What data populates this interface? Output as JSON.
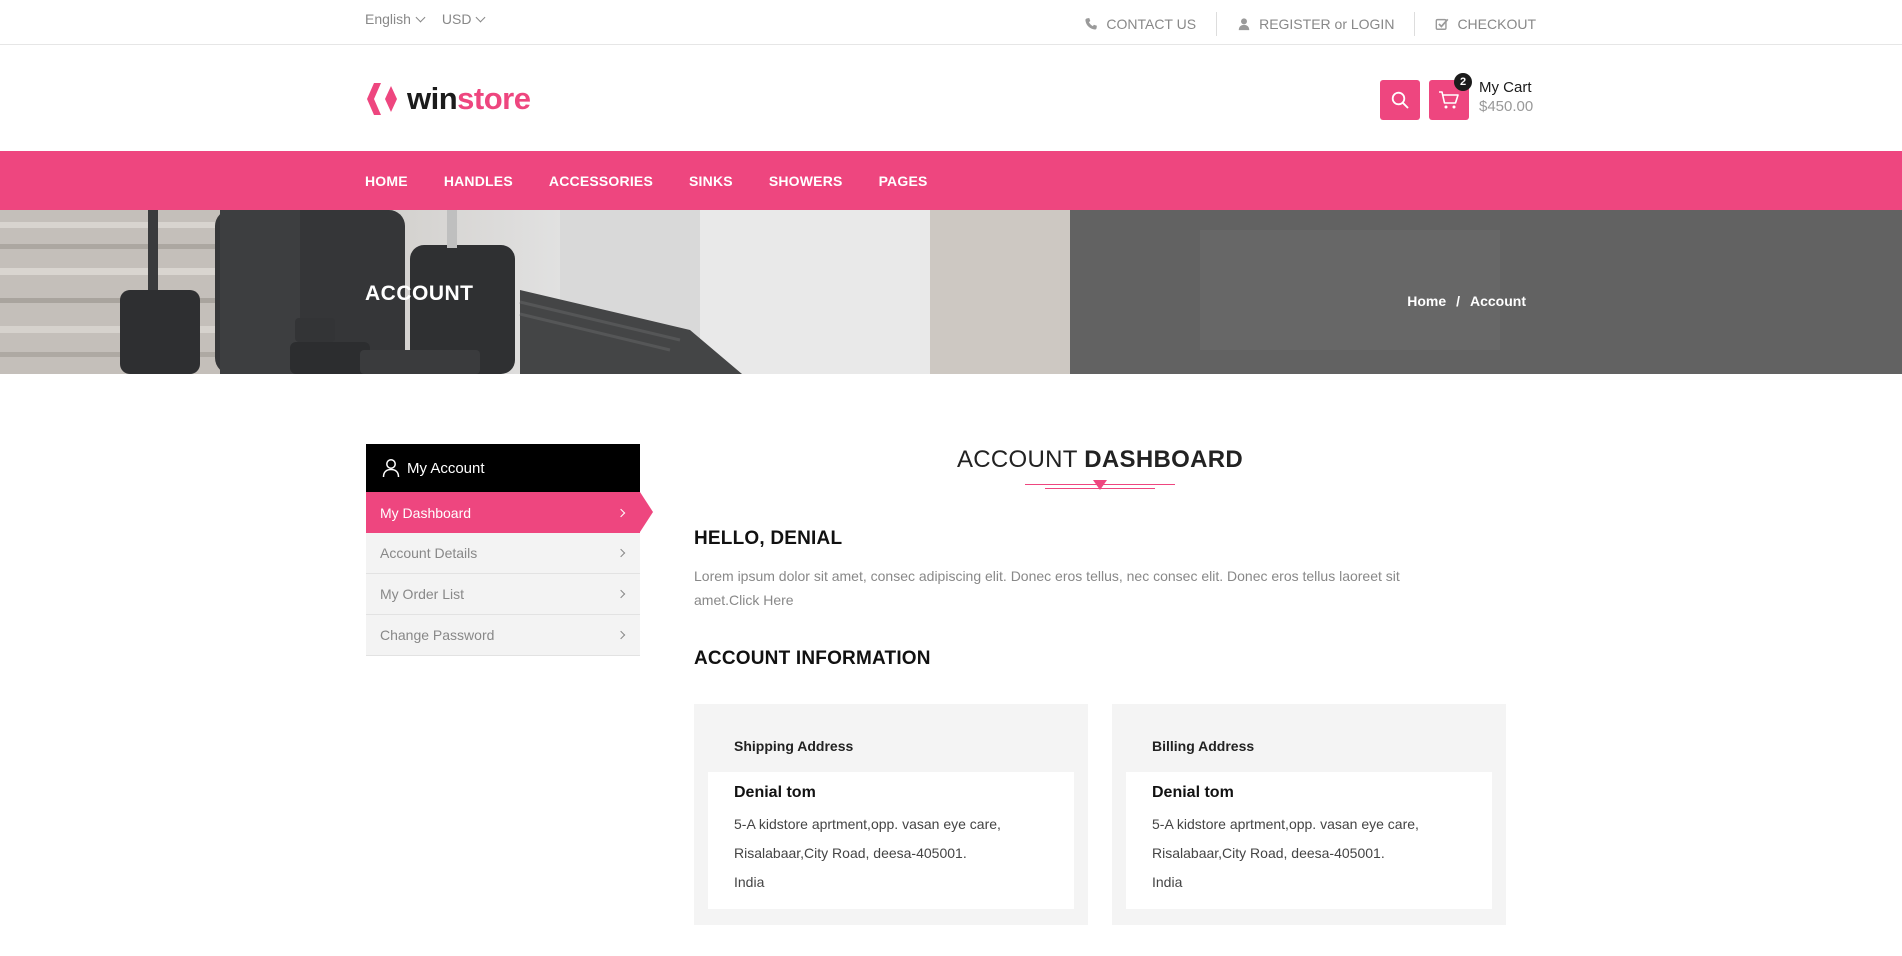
{
  "topbar": {
    "language": "English",
    "currency": "USD",
    "contact": "CONTACT US",
    "register": "REGISTER or LOGIN",
    "checkout": "CHECKOUT"
  },
  "brand": {
    "name_part1": "win",
    "name_part2": "store",
    "accent_color": "#ee467f",
    "dark_color": "#1b1b1b"
  },
  "cart": {
    "count": "2",
    "label": "My Cart",
    "total": "$450.00"
  },
  "nav": [
    "HOME",
    "HANDLES",
    "ACCESSORIES",
    "SINKS",
    "SHOWERS",
    "PAGES"
  ],
  "banner": {
    "title": "ACCOUNT",
    "breadcrumb_home": "Home",
    "breadcrumb_sep": "/",
    "breadcrumb_current": "Account"
  },
  "sidebar": {
    "header": "My Account",
    "items": [
      "My Dashboard",
      "Account Details",
      "My Order List",
      "Change Password"
    ],
    "active_index": 0
  },
  "main": {
    "title_light": "ACCOUNT",
    "title_bold": "DASHBOARD",
    "hello": "HELLO, DENIAL",
    "intro": "Lorem ipsum dolor sit amet, consec adipiscing elit. Donec eros tellus, nec consec elit. Donec eros tellus laoreet sit amet.",
    "intro_link": "Click Here",
    "info_heading": "ACCOUNT INFORMATION",
    "shipping": {
      "title": "Shipping Address",
      "name": "Denial tom",
      "line1": "5-A kidstore aprtment,opp. vasan eye care,",
      "line2": "Risalabaar,City Road, deesa-405001.",
      "country": "India"
    },
    "billing": {
      "title": "Billing Address",
      "name": "Denial tom",
      "line1": "5-A kidstore aprtment,opp. vasan eye care,",
      "line2": "Risalabaar,City Road, deesa-405001.",
      "country": "India"
    }
  },
  "icons": {
    "phone": "phone-icon",
    "user": "user-icon",
    "check": "checkbox-icon",
    "search": "search-icon",
    "cart": "cart-icon"
  }
}
